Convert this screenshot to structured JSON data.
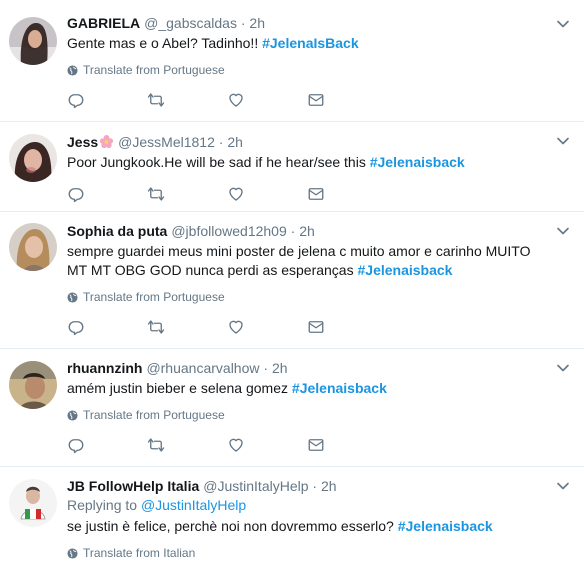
{
  "colors": {
    "hashtag": "#1b95e0",
    "muted": "#657786",
    "border": "#e6ecf0"
  },
  "icons": {
    "reply": "reply-icon",
    "retweet": "retweet-icon",
    "like": "heart-icon",
    "dm": "envelope-icon",
    "globe": "globe-icon",
    "caret": "chevron-down-icon"
  },
  "tweets": [
    {
      "name": "GABRIELA",
      "handle": "@_gabscaldas",
      "dot": "·",
      "time": "2h",
      "text": "Gente mas e o Abel? Tadinho!! ",
      "hashtag": "#JelenaIsBack",
      "translate": "Translate from Portuguese"
    },
    {
      "name": "Jess",
      "handle": "@JessMel1812",
      "dot": "·",
      "time": "2h",
      "text": "Poor Jungkook.He will be sad if he hear/see this ",
      "hashtag": "#Jelenaisback"
    },
    {
      "name": "Sophia da puta",
      "handle": "@jbfollowed12h09",
      "dot": "·",
      "time": "2h",
      "text": "sempre guardei meus mini poster de jelena c muito amor e carinho MUITO MT MT OBG GOD nunca perdi as esperanças ",
      "hashtag": "#Jelenaisback",
      "translate": "Translate from Portuguese"
    },
    {
      "name": "rhuannzinh",
      "handle": "@rhuancarvalhow",
      "dot": "·",
      "time": "2h",
      "text": "amém justin bieber e selena gomez ",
      "hashtag": "#Jelenaisback",
      "translate": "Translate from Portuguese"
    },
    {
      "name": "JB FollowHelp Italia",
      "handle": "@JustinItalyHelp",
      "dot": "·",
      "time": "2h",
      "replying_prefix": "Replying to ",
      "replying_to": "@JustinItalyHelp",
      "text": "se justin è felice, perchè noi non dovremmo esserlo? ",
      "hashtag": "#Jelenaisback",
      "translate": "Translate from Italian"
    }
  ]
}
